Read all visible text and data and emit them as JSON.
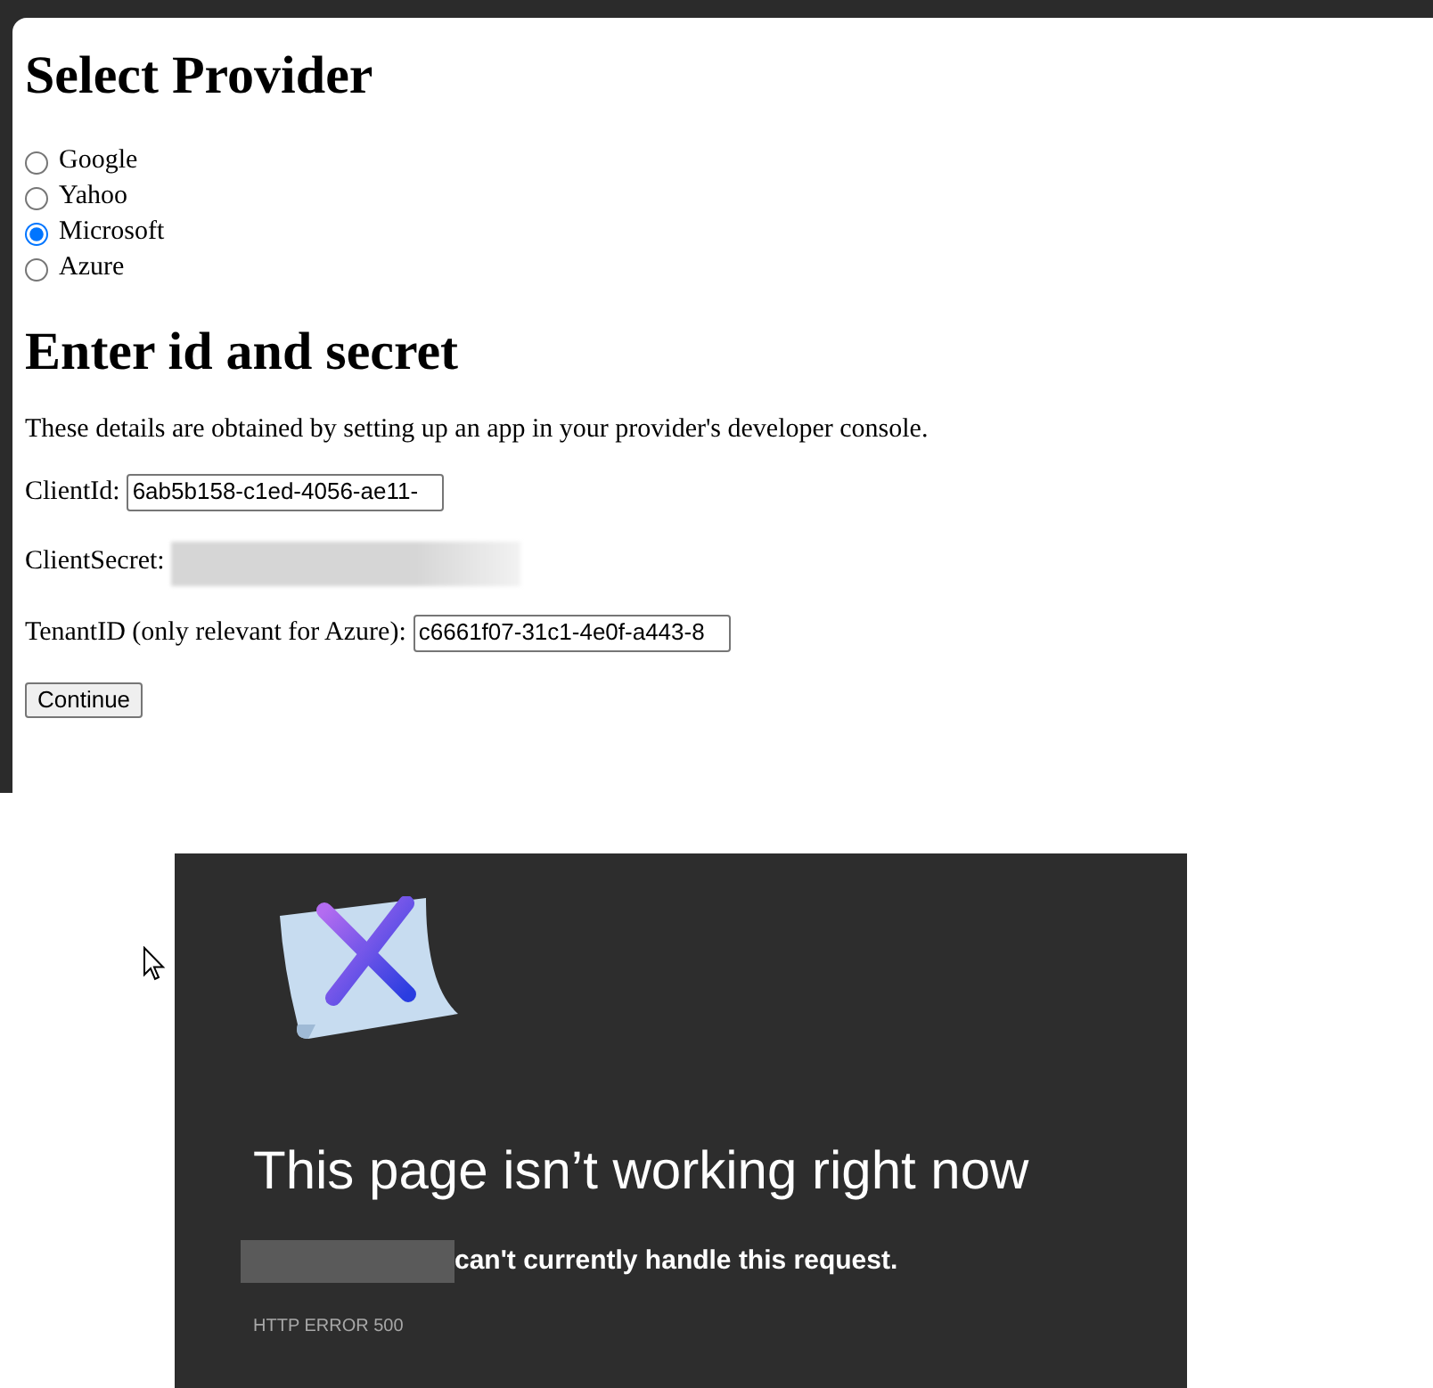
{
  "provider_form": {
    "title": "Select Provider",
    "providers": [
      {
        "label": "Google",
        "selected": false
      },
      {
        "label": "Yahoo",
        "selected": false
      },
      {
        "label": "Microsoft",
        "selected": true
      },
      {
        "label": "Azure",
        "selected": false
      }
    ],
    "section_title": "Enter id and secret",
    "description": "These details are obtained by setting up an app in your provider's developer console.",
    "fields": [
      {
        "kind": "text",
        "label": "ClientId:",
        "value": "6ab5b158-c1ed-4056-ae11-"
      },
      {
        "kind": "redacted",
        "label": "ClientSecret:"
      },
      {
        "kind": "text",
        "label": "TenantID (only relevant for Azure):",
        "value": "c6661f07-31c1-4e0f-a443-8"
      }
    ],
    "button": "Continue"
  },
  "error_page": {
    "title": "This page isn’t working right now",
    "message": "can't currently handle this request.",
    "code": "HTTP ERROR 500"
  }
}
